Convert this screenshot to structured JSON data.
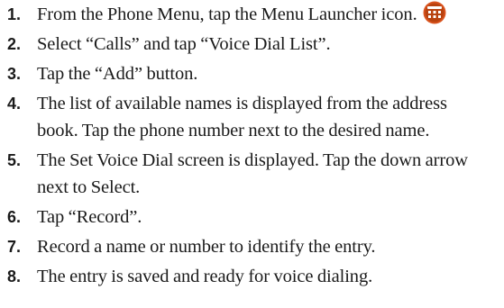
{
  "steps": [
    {
      "number": "1.",
      "lines": [
        "From the Phone Menu, tap the Menu Launcher icon."
      ],
      "icon": "menu-launcher-icon"
    },
    {
      "number": "2.",
      "lines": [
        "Select “Calls” and tap “Voice Dial List”."
      ]
    },
    {
      "number": "3.",
      "lines": [
        "Tap the “Add” button."
      ]
    },
    {
      "number": "4.",
      "lines": [
        "The list of available names is displayed from the address",
        "book. Tap the phone number next to the desired name."
      ]
    },
    {
      "number": "5.",
      "lines": [
        "The Set Voice Dial screen is displayed. Tap the down arrow",
        "next to Select."
      ]
    },
    {
      "number": "6.",
      "lines": [
        "Tap “Record”."
      ]
    },
    {
      "number": "7.",
      "lines": [
        "Record a name or number to identify the entry."
      ]
    },
    {
      "number": "8.",
      "lines": [
        "The entry is saved and ready for voice dialing."
      ]
    }
  ],
  "colors": {
    "text": "#1a1a1a",
    "icon_bg": "#d9531e"
  }
}
